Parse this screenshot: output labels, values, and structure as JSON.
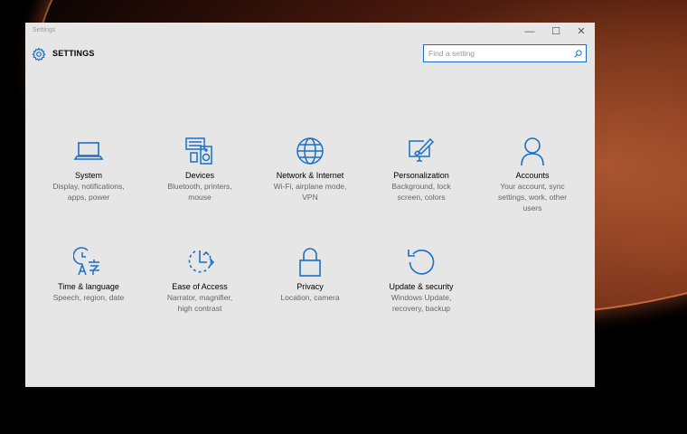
{
  "window": {
    "title": "Settings",
    "controls": {
      "minimize": "—",
      "maximize": "☐",
      "close": "✕"
    }
  },
  "header": {
    "title": "SETTINGS"
  },
  "search": {
    "placeholder": "Find a setting"
  },
  "categories": [
    {
      "name": "System",
      "desc1": "Display, notifications,",
      "desc2": "apps, power",
      "desc3": "",
      "icon": "laptop-icon"
    },
    {
      "name": "Devices",
      "desc1": "Bluetooth, printers,",
      "desc2": "mouse",
      "desc3": "",
      "icon": "devices-icon"
    },
    {
      "name": "Network & Internet",
      "desc1": "Wi-Fi, airplane mode,",
      "desc2": "VPN",
      "desc3": "",
      "icon": "globe-icon"
    },
    {
      "name": "Personalization",
      "desc1": "Background, lock",
      "desc2": "screen, colors",
      "desc3": "",
      "icon": "personalization-icon"
    },
    {
      "name": "Accounts",
      "desc1": "Your account, sync",
      "desc2": "settings, work, other",
      "desc3": "users",
      "icon": "person-icon"
    },
    {
      "name": "Time & language",
      "desc1": "Speech, region, date",
      "desc2": "",
      "desc3": "",
      "icon": "time-language-icon"
    },
    {
      "name": "Ease of Access",
      "desc1": "Narrator, magnifier,",
      "desc2": "high contrast",
      "desc3": "",
      "icon": "ease-of-access-icon"
    },
    {
      "name": "Privacy",
      "desc1": "Location, camera",
      "desc2": "",
      "desc3": "",
      "icon": "lock-icon"
    },
    {
      "name": "Update & security",
      "desc1": "Windows Update,",
      "desc2": "recovery, backup",
      "desc3": "",
      "icon": "update-icon"
    }
  ],
  "colors": {
    "accent": "#1a6fc7",
    "window_bg": "#e6e6e6"
  }
}
